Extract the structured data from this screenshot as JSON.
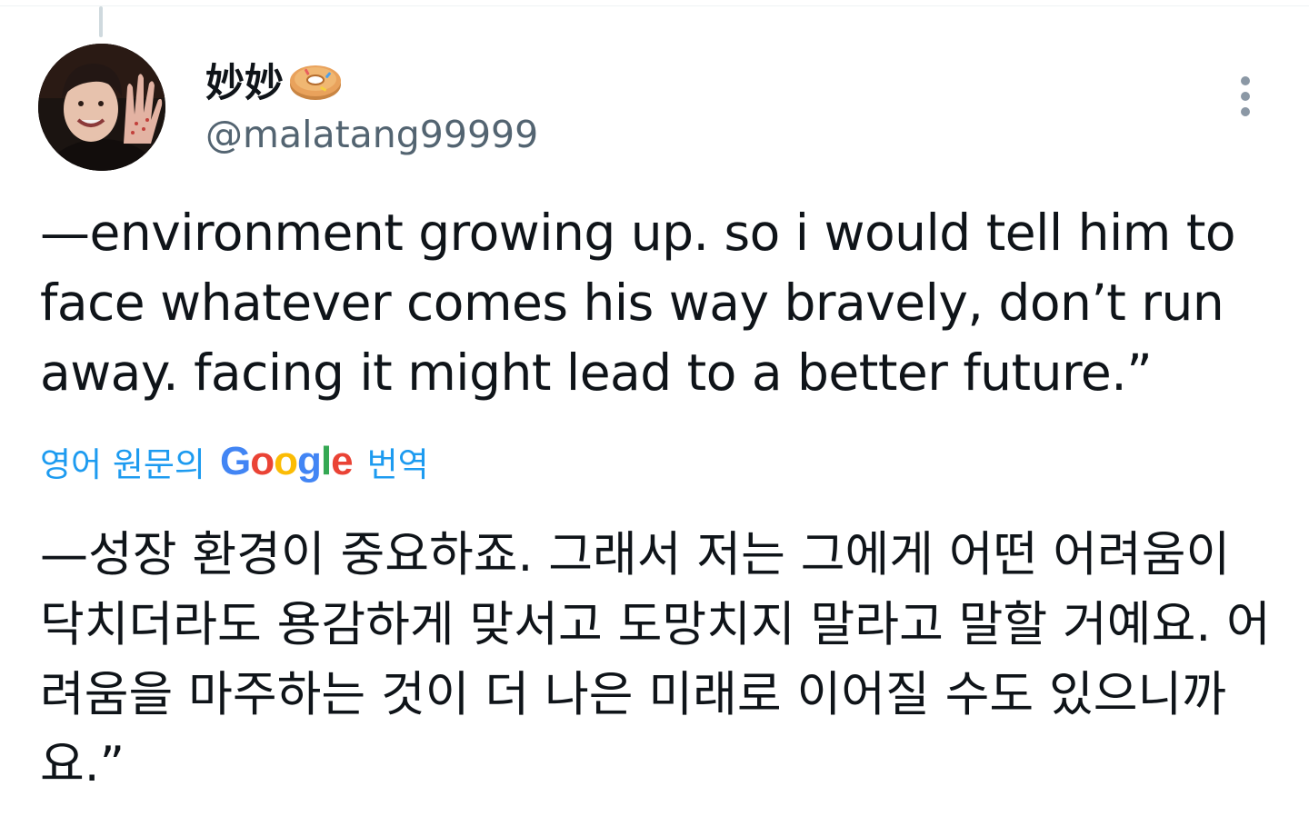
{
  "tweet": {
    "display_name": "妙妙",
    "handle": "@malatang99999",
    "name_emoji_icon": "donut-icon",
    "more_icon": "more-vertical-icon",
    "text": "—environment growing up. so i would tell him to face whatever comes his way bravely, don’t run away. facing it might lead to a better future.”",
    "translation": {
      "prefix": "영어 원문의",
      "provider_letters": [
        "G",
        "o",
        "o",
        "g",
        "l",
        "e"
      ],
      "provider_colors": [
        "#4285F4",
        "#EA4335",
        "#FBBC05",
        "#4285F4",
        "#34A853",
        "#EA4335"
      ],
      "suffix": "번역",
      "text": "—성장 환경이 중요하죠. 그래서 저는 그에게 어떤 어려움이 닥치더라도 용감하게 맞서고 도망치지 말라고 말할 거예요. 어려움을 마주하는 것이 더 나은 미래로 이어질 수도 있으니까요.”"
    }
  },
  "colors": {
    "text_primary": "#0f1419",
    "text_secondary": "#536471",
    "link": "#1d9bf0"
  }
}
